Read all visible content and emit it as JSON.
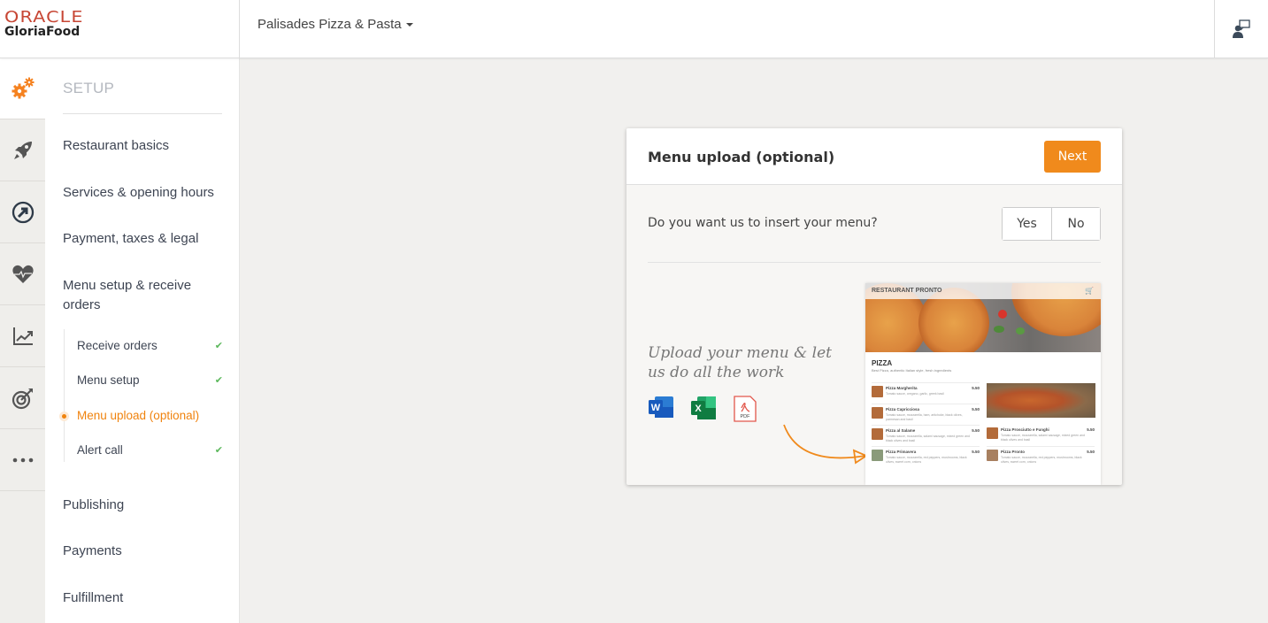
{
  "brand": {
    "line1": "ORACLE",
    "line2": "GloriaFood"
  },
  "header": {
    "restaurant_name": "Palisades Pizza & Pasta",
    "support_icon": "support-agent-icon"
  },
  "icon_rail": [
    {
      "icon": "gears-icon",
      "active": true
    },
    {
      "icon": "rocket-icon"
    },
    {
      "icon": "circle-arrow-icon"
    },
    {
      "icon": "heart-pulse-icon"
    },
    {
      "icon": "chart-line-icon"
    },
    {
      "icon": "target-icon"
    },
    {
      "icon": "more-icon"
    }
  ],
  "sidenav": {
    "section_title": "SETUP",
    "items": [
      {
        "label": "Restaurant basics"
      },
      {
        "label": "Services & opening hours"
      },
      {
        "label": "Payment, taxes & legal"
      },
      {
        "label": "Menu setup & receive orders"
      },
      {
        "label": "Publishing"
      },
      {
        "label": "Payments"
      },
      {
        "label": "Fulfillment"
      }
    ],
    "subitems": [
      {
        "label": "Receive orders",
        "done": true
      },
      {
        "label": "Menu setup",
        "done": true
      },
      {
        "label": "Menu upload (optional)",
        "active": true
      },
      {
        "label": "Alert call",
        "done": true
      }
    ]
  },
  "card": {
    "title": "Menu upload (optional)",
    "next_label": "Next",
    "question": "Do you want us to insert your menu?",
    "yes_label": "Yes",
    "no_label": "No",
    "promo_text": "Upload your menu & let us do all the work",
    "file_types": [
      "Word",
      "Excel",
      "PDF"
    ],
    "pdf_label": "PDF",
    "word_letter": "W",
    "excel_letter": "X"
  },
  "preview": {
    "restaurant": "RESTAURANT PRONTO",
    "category": "PIZZA",
    "category_desc": "Best Pizza, authentic Italian style, fresh ingredients",
    "items": [
      {
        "name": "Pizza Margherita",
        "price": "5.50",
        "desc": "Tomato sauce, oregano, garlic, greek basil"
      },
      {
        "name": "Pizza Capricciosa",
        "price": "5.50",
        "desc": "Tomato sauce, mozzarella, ham, artichoke, black olives, parmesan and basil"
      },
      {
        "name": "Pizza al Salame",
        "price": "5.50",
        "desc": "Tomato sauce, mozzarella, salami sausage, mixed green and black olives and basil"
      },
      {
        "name": "Pizza Primavera",
        "price": "5.50",
        "desc": "Tomato sauce, mozzarella, red peppers, mushrooms, black olives, sweet corn, onions"
      },
      {
        "name": "Pizza Prosciutto e Funghi",
        "price": "5.50",
        "desc": "Tomato sauce, mozzarella, salami sausage, mixed green and black olives and basil"
      },
      {
        "name": "Pizza Pronto",
        "price": "5.50",
        "desc": "Tomato sauce, mozzarella, red peppers, mushrooms, black olives, sweet corn, onions"
      }
    ]
  },
  "colors": {
    "accent": "#f08a1c",
    "oracle_red": "#c74634",
    "check": "#5cb85c"
  }
}
